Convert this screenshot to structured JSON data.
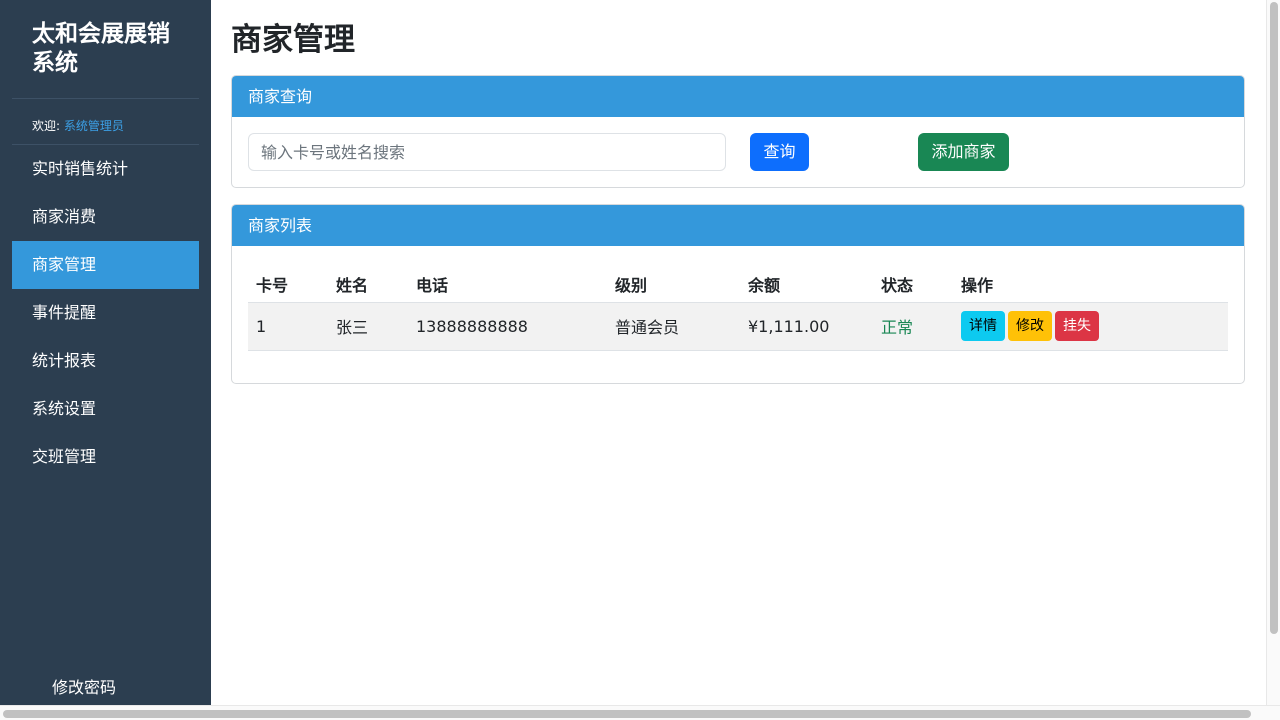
{
  "sidebar": {
    "brand": "太和会展展销系统",
    "welcome_label": "欢迎:",
    "user_name": "系统管理员",
    "items": [
      {
        "label": "实时销售统计"
      },
      {
        "label": "商家消费"
      },
      {
        "label": "商家管理",
        "active": true
      },
      {
        "label": "事件提醒"
      },
      {
        "label": "统计报表"
      },
      {
        "label": "系统设置"
      },
      {
        "label": "交班管理"
      }
    ],
    "change_password": "修改密码"
  },
  "page": {
    "title": "商家管理"
  },
  "search_card": {
    "header": "商家查询",
    "input_placeholder": "输入卡号或姓名搜索",
    "input_value": "",
    "query_button": "查询",
    "add_button": "添加商家"
  },
  "list_card": {
    "header": "商家列表",
    "columns": [
      "卡号",
      "姓名",
      "电话",
      "级别",
      "余额",
      "状态",
      "操作"
    ],
    "rows": [
      {
        "card_no": "1",
        "name": "张三",
        "phone": "13888888888",
        "level": "普通会员",
        "balance": "¥1,111.00",
        "status": "正常",
        "actions": {
          "detail": "详情",
          "edit": "修改",
          "lost": "挂失"
        }
      }
    ]
  },
  "colors": {
    "sidebar_bg": "#2c3e50",
    "accent": "#3498db",
    "primary": "#0d6efd",
    "success": "#198754",
    "info": "#0dcaf0",
    "warning": "#ffc107",
    "danger": "#dc3545"
  }
}
